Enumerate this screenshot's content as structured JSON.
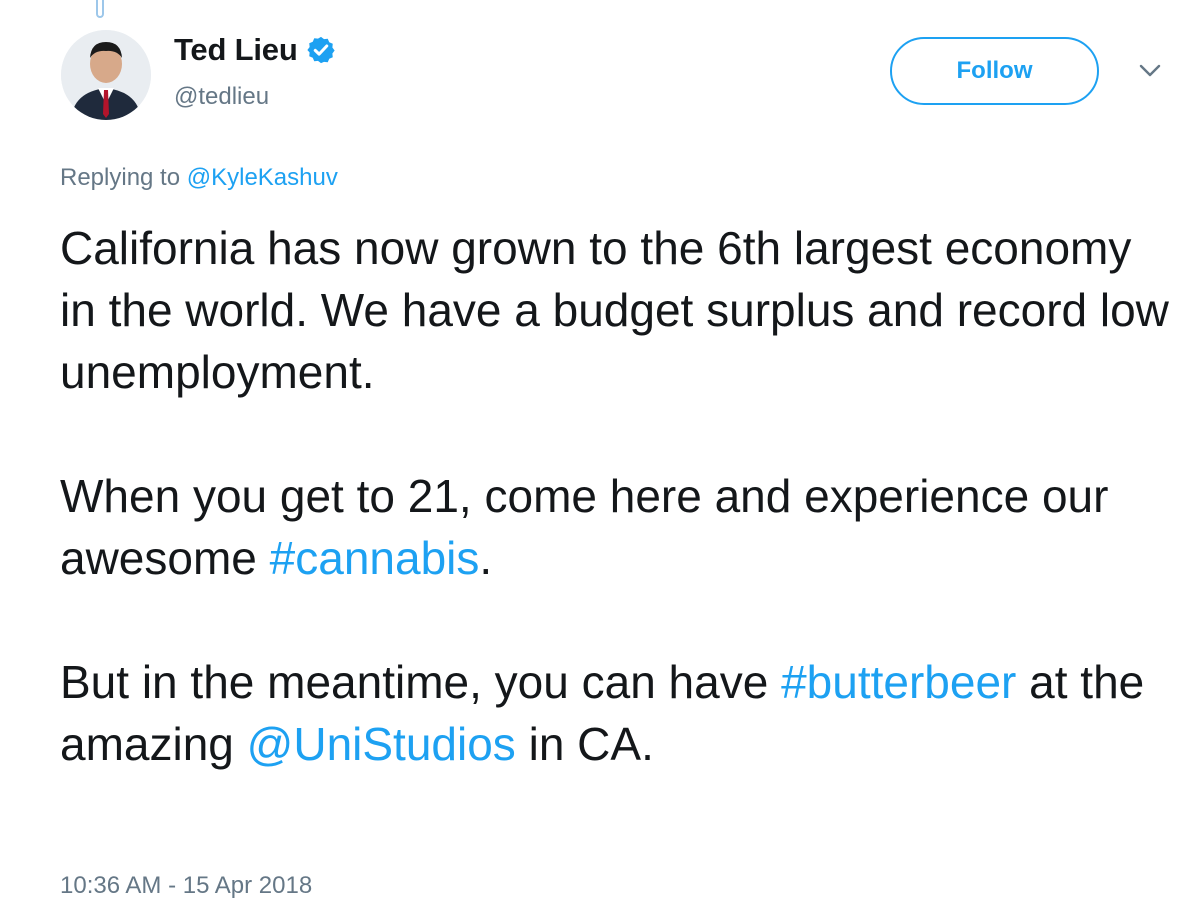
{
  "author": {
    "display_name": "Ted Lieu",
    "handle": "@tedlieu",
    "verified_icon": "verified-badge-icon",
    "avatar": "profile-photo"
  },
  "actions": {
    "follow_label": "Follow",
    "more_icon": "chevron-down-icon"
  },
  "reply_context": {
    "prefix": "Replying to",
    "mention": "@KyleKashuv"
  },
  "tweet": {
    "paragraph_1": "California has now grown to the 6th largest economy in the world. We have a budget surplus and record low unemployment.",
    "paragraph_2_text_a": "When you get to 21, come here and experience our awesome ",
    "paragraph_2_hashtag": "#cannabis",
    "paragraph_2_text_b": ".",
    "paragraph_3_text_a": "But in the meantime, you can have ",
    "paragraph_3_hashtag": "#butterbeer",
    "paragraph_3_text_b": " at the amazing ",
    "paragraph_3_mention": "@UniStudios",
    "paragraph_3_text_c": " in CA."
  },
  "timestamp": "10:36 AM - 15 Apr 2018",
  "colors": {
    "link": "#1da1f2",
    "muted": "#657786",
    "text": "#14171a"
  }
}
